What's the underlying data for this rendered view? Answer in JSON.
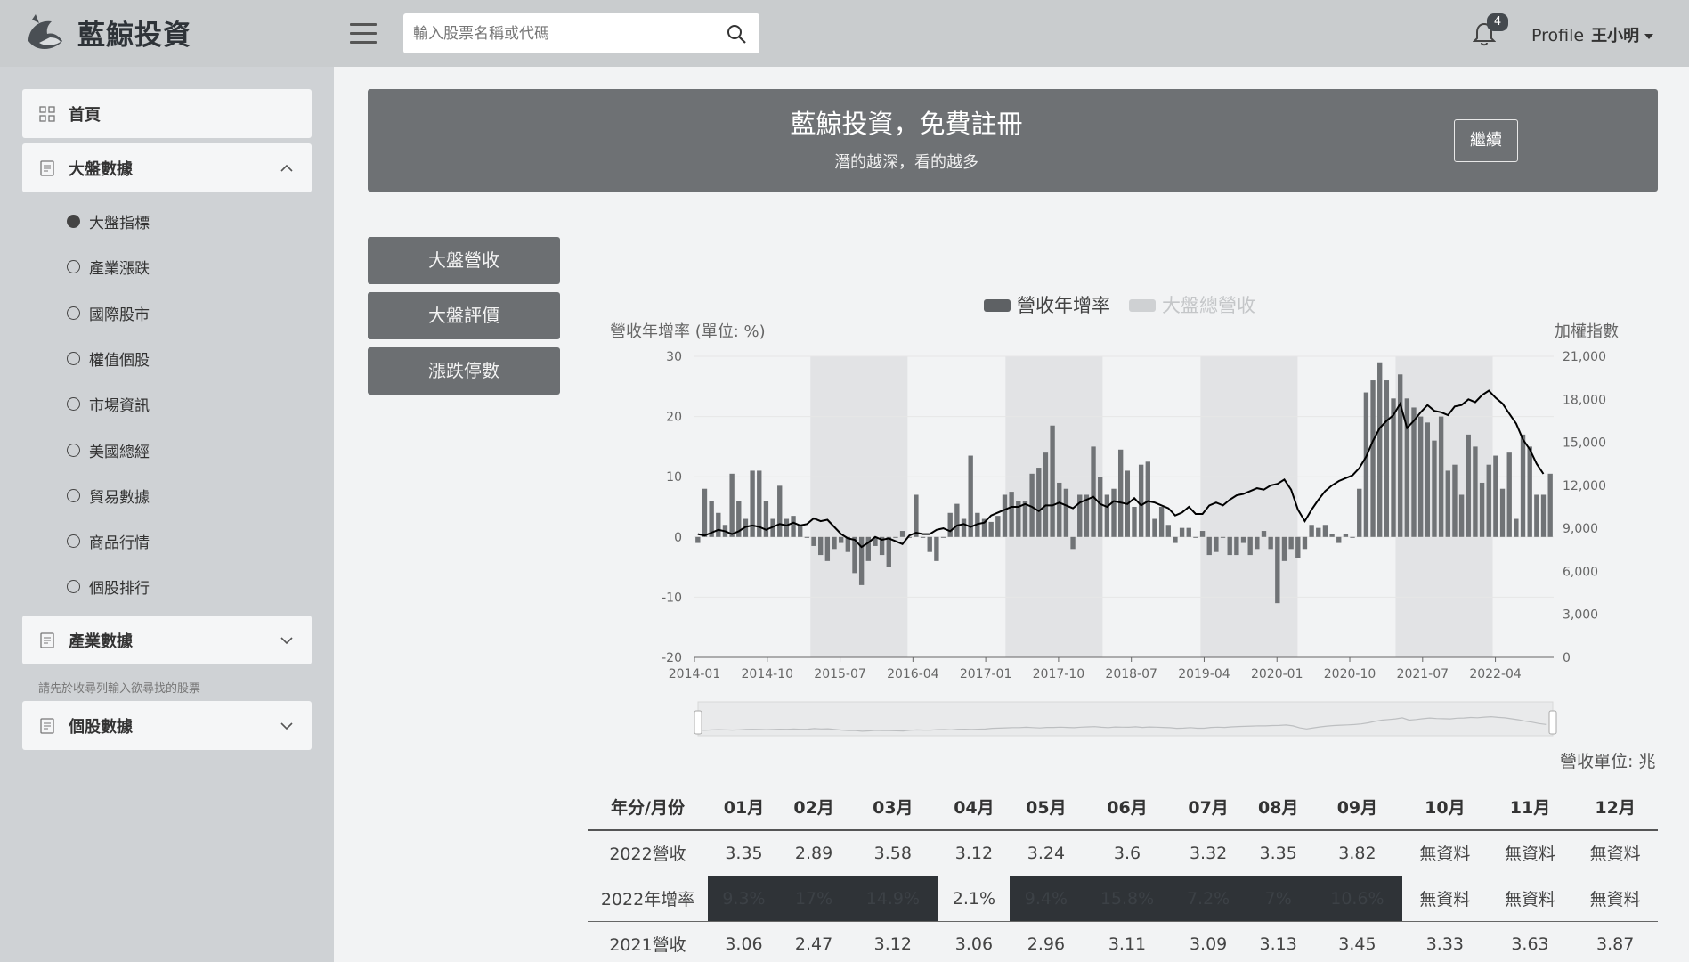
{
  "header": {
    "brand": "藍鯨投資",
    "search_placeholder": "輸入股票名稱或代碼",
    "notification_count": "4",
    "profile_alt": "Profile",
    "user_name": "王小明"
  },
  "sidebar": {
    "home_label": "首頁",
    "market_section_label": "大盤數據",
    "market_items": [
      "大盤指標",
      "產業漲跌",
      "國際股市",
      "權值個股",
      "市場資訊",
      "美國總經",
      "貿易數據",
      "商品行情",
      "個股排行"
    ],
    "industry_section_label": "產業數據",
    "hint": "請先於收尋列輸入欲尋找的股票",
    "stock_section_label": "個股數據"
  },
  "banner": {
    "title": "藍鯨投資，免費註冊",
    "subtitle": "潛的越深，看的越多",
    "button_label": "繼續"
  },
  "tabs": [
    "大盤營收",
    "大盤評價",
    "漲跌停數"
  ],
  "chart_data": {
    "type": "bar",
    "legend": [
      "營收年增率",
      "大盤總營收"
    ],
    "ylabel_left": "營收年增率 (單位: %)",
    "ylabel_right": "加權指數",
    "y_left_ticks": [
      "30",
      "20",
      "10",
      "0",
      "-10",
      "-20"
    ],
    "y_right_ticks": [
      "21,000",
      "18,000",
      "15,000",
      "12,000",
      "9,000",
      "6,000",
      "3,000",
      "0"
    ],
    "ylim_left": [
      -20,
      30
    ],
    "ylim_right": [
      0,
      21000
    ],
    "x_ticks": [
      "2014-01",
      "2014-10",
      "2015-07",
      "2016-04",
      "2017-01",
      "2017-10",
      "2018-07",
      "2019-04",
      "2020-01",
      "2020-10",
      "2021-07",
      "2022-04"
    ],
    "series": [
      {
        "name": "營收年增率",
        "values": [
          -1,
          8,
          6,
          4,
          2,
          10.5,
          6,
          3,
          11,
          11,
          6,
          3,
          8.5,
          3,
          3.5,
          2,
          0,
          -1.5,
          -3,
          -4,
          -2,
          -1,
          -2.5,
          -6,
          -8,
          -4,
          -1.5,
          -3,
          -5,
          0,
          1,
          0,
          7,
          0,
          -2.5,
          -4,
          0,
          4,
          5.5,
          3,
          13.5,
          4,
          3,
          2.5,
          3.5,
          7,
          7.5,
          6,
          6,
          10.5,
          11.5,
          14,
          18.5,
          9,
          8,
          -2,
          7,
          7,
          15,
          10,
          7,
          8,
          14.5,
          11,
          5,
          12,
          12.5,
          3,
          5,
          2,
          -1,
          1.5,
          1.5,
          0,
          1,
          -3,
          -2.5,
          0,
          -3,
          -3,
          -1,
          -3,
          -2,
          1,
          -2,
          -11,
          -4,
          -2,
          -3.5,
          -2,
          2,
          1.5,
          2,
          0.5,
          -1,
          0.5,
          0,
          8,
          24,
          26,
          29,
          26,
          23,
          27,
          23,
          21.5,
          20,
          19,
          16,
          20,
          11,
          12,
          7,
          17,
          15,
          9,
          12,
          13.5,
          8,
          14,
          3,
          17,
          15,
          7,
          7,
          10.5
        ]
      },
      {
        "name": "加權指數",
        "values": [
          8600,
          8500,
          8700,
          8900,
          8800,
          8600,
          8800,
          9100,
          9200,
          9100,
          8900,
          9100,
          9300,
          9200,
          9400,
          9200,
          9300,
          9700,
          9500,
          9600,
          9100,
          8600,
          8300,
          8200,
          7700,
          8000,
          8400,
          8200,
          8300,
          8100,
          7900,
          8500,
          8700,
          8600,
          8600,
          8900,
          9000,
          8800,
          9200,
          9300,
          9100,
          9300,
          9400,
          9900,
          10100,
          10300,
          10500,
          10500,
          10700,
          10500,
          10200,
          10600,
          10600,
          10800,
          10600,
          10400,
          10800,
          11000,
          11200,
          10700,
          10500,
          10900,
          10800,
          10700,
          11100,
          10600,
          10900,
          10800,
          10600,
          10400,
          9900,
          10100,
          10500,
          10000,
          10000,
          10600,
          10800,
          10600,
          11000,
          11300,
          11400,
          11600,
          11800,
          11700,
          12000,
          12100,
          12400,
          11700,
          10300,
          9500,
          10300,
          11000,
          11600,
          12000,
          12300,
          12500,
          12700,
          13200,
          14000,
          15100,
          16000,
          16500,
          16900,
          17700,
          16000,
          16500,
          17100,
          17600,
          17200,
          17100,
          16900,
          17500,
          17600,
          18000,
          17800,
          18300,
          18600,
          18100,
          17700,
          17000,
          16300,
          15200,
          14500,
          13500,
          12800
        ]
      }
    ]
  },
  "unit_note": "營收單位: 兆",
  "table": {
    "headers": [
      "年分/月份",
      "01月",
      "02月",
      "03月",
      "04月",
      "05月",
      "06月",
      "07月",
      "08月",
      "09月",
      "10月",
      "11月",
      "12月"
    ],
    "row_2022_rev": [
      "2022營收",
      "3.35",
      "2.89",
      "3.58",
      "3.12",
      "3.24",
      "3.6",
      "3.32",
      "3.35",
      "3.82",
      "無資料",
      "無資料",
      "無資料"
    ],
    "row_2022_growth": [
      "2022年增率",
      "9.3%",
      "17%",
      "14.9%",
      "2.1%",
      "9.4%",
      "15.8%",
      "7.2%",
      "7%",
      "10.6%",
      "無資料",
      "無資料",
      "無資料"
    ],
    "row_2021_rev": [
      "2021營收",
      "3.06",
      "2.47",
      "3.12",
      "3.06",
      "2.96",
      "3.11",
      "3.09",
      "3.13",
      "3.45",
      "3.33",
      "3.63",
      "3.87"
    ]
  },
  "colors": {
    "bar": "#707376",
    "line": "#000000",
    "band": "#e2e3e5",
    "dark_cell": "#2f3337"
  }
}
